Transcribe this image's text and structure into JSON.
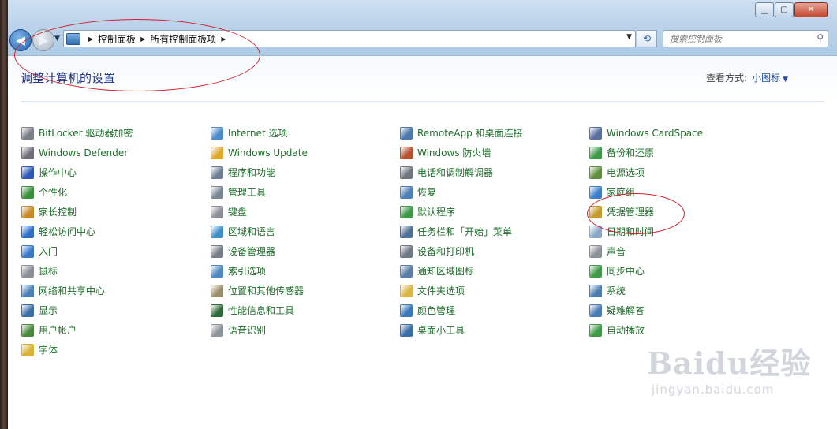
{
  "address": {
    "crumbs": [
      "控制面板",
      "所有控制面板项"
    ]
  },
  "search": {
    "placeholder": "搜索控制面板"
  },
  "header": {
    "title": "调整计算机的设置",
    "view_label": "查看方式:",
    "view_value": "小图标"
  },
  "columns": [
    [
      {
        "label": "BitLocker 驱动器加密",
        "icon": "bitlocker-icon",
        "color": "#7a7f88"
      },
      {
        "label": "Windows Defender",
        "icon": "defender-icon",
        "color": "#6b6f77"
      },
      {
        "label": "操作中心",
        "icon": "flag-icon",
        "color": "#2d58b8"
      },
      {
        "label": "个性化",
        "icon": "personalize-icon",
        "color": "#3a8f3d"
      },
      {
        "label": "家长控制",
        "icon": "parental-icon",
        "color": "#c7892a"
      },
      {
        "label": "轻松访问中心",
        "icon": "ease-access-icon",
        "color": "#2f6fc6"
      },
      {
        "label": "入门",
        "icon": "getting-started-icon",
        "color": "#3a79c9"
      },
      {
        "label": "鼠标",
        "icon": "mouse-icon",
        "color": "#8a8f96"
      },
      {
        "label": "网络和共享中心",
        "icon": "network-icon",
        "color": "#4a7fb8"
      },
      {
        "label": "显示",
        "icon": "display-icon",
        "color": "#3d6ea8"
      },
      {
        "label": "用户帐户",
        "icon": "user-icon",
        "color": "#4b8a3e"
      },
      {
        "label": "字体",
        "icon": "font-folder-icon",
        "color": "#d9b23a"
      }
    ],
    [
      {
        "label": "Internet 选项",
        "icon": "internet-icon",
        "color": "#4a8ccf"
      },
      {
        "label": "Windows Update",
        "icon": "update-icon",
        "color": "#e0a62a"
      },
      {
        "label": "程序和功能",
        "icon": "programs-icon",
        "color": "#6d7f95"
      },
      {
        "label": "管理工具",
        "icon": "admin-tools-icon",
        "color": "#7a8796"
      },
      {
        "label": "键盘",
        "icon": "keyboard-icon",
        "color": "#8b9098"
      },
      {
        "label": "区域和语言",
        "icon": "region-icon",
        "color": "#3f8dc9"
      },
      {
        "label": "设备管理器",
        "icon": "device-manager-icon",
        "color": "#767d87"
      },
      {
        "label": "索引选项",
        "icon": "index-icon",
        "color": "#4d88c4"
      },
      {
        "label": "位置和其他传感器",
        "icon": "sensor-icon",
        "color": "#9a8f6a"
      },
      {
        "label": "性能信息和工具",
        "icon": "performance-icon",
        "color": "#2f6b3a"
      },
      {
        "label": "语音识别",
        "icon": "microphone-icon",
        "color": "#8e949b"
      }
    ],
    [
      {
        "label": "RemoteApp 和桌面连接",
        "icon": "remoteapp-icon",
        "color": "#4b79b0"
      },
      {
        "label": "Windows 防火墙",
        "icon": "firewall-icon",
        "color": "#b5522f"
      },
      {
        "label": "电话和调制解调器",
        "icon": "phone-icon",
        "color": "#6f7780"
      },
      {
        "label": "恢复",
        "icon": "recovery-icon",
        "color": "#4e7fb8"
      },
      {
        "label": "默认程序",
        "icon": "default-programs-icon",
        "color": "#3f9a48"
      },
      {
        "label": "任务栏和「开始」菜单",
        "icon": "taskbar-icon",
        "color": "#4f6e96"
      },
      {
        "label": "设备和打印机",
        "icon": "printer-icon",
        "color": "#6f7a86"
      },
      {
        "label": "通知区域图标",
        "icon": "notification-icon",
        "color": "#5a7ea8"
      },
      {
        "label": "文件夹选项",
        "icon": "folder-options-icon",
        "color": "#dcb54a"
      },
      {
        "label": "颜色管理",
        "icon": "color-mgmt-icon",
        "color": "#3c78bc"
      },
      {
        "label": "桌面小工具",
        "icon": "gadgets-icon",
        "color": "#3b6fa8"
      }
    ],
    [
      {
        "label": "Windows CardSpace",
        "icon": "cardspace-icon",
        "color": "#5a6fa0"
      },
      {
        "label": "备份和还原",
        "icon": "backup-icon",
        "color": "#3f9a48"
      },
      {
        "label": "电源选项",
        "icon": "power-icon",
        "color": "#5d8f3e"
      },
      {
        "label": "家庭组",
        "icon": "homegroup-icon",
        "color": "#3c7fc9"
      },
      {
        "label": "凭据管理器",
        "icon": "credential-icon",
        "color": "#c49a2f"
      },
      {
        "label": "日期和时间",
        "icon": "clock-icon",
        "color": "#8aa7c8"
      },
      {
        "label": "声音",
        "icon": "speaker-icon",
        "color": "#8a9098"
      },
      {
        "label": "同步中心",
        "icon": "sync-icon",
        "color": "#3f9a48"
      },
      {
        "label": "系统",
        "icon": "system-icon",
        "color": "#4d7cb0"
      },
      {
        "label": "疑难解答",
        "icon": "troubleshoot-icon",
        "color": "#4b7bb3"
      },
      {
        "label": "自动播放",
        "icon": "autoplay-icon",
        "color": "#3f9a48"
      }
    ]
  ],
  "watermark": {
    "main": "Baidu经验",
    "sub": "jingyan.baidu.com"
  }
}
